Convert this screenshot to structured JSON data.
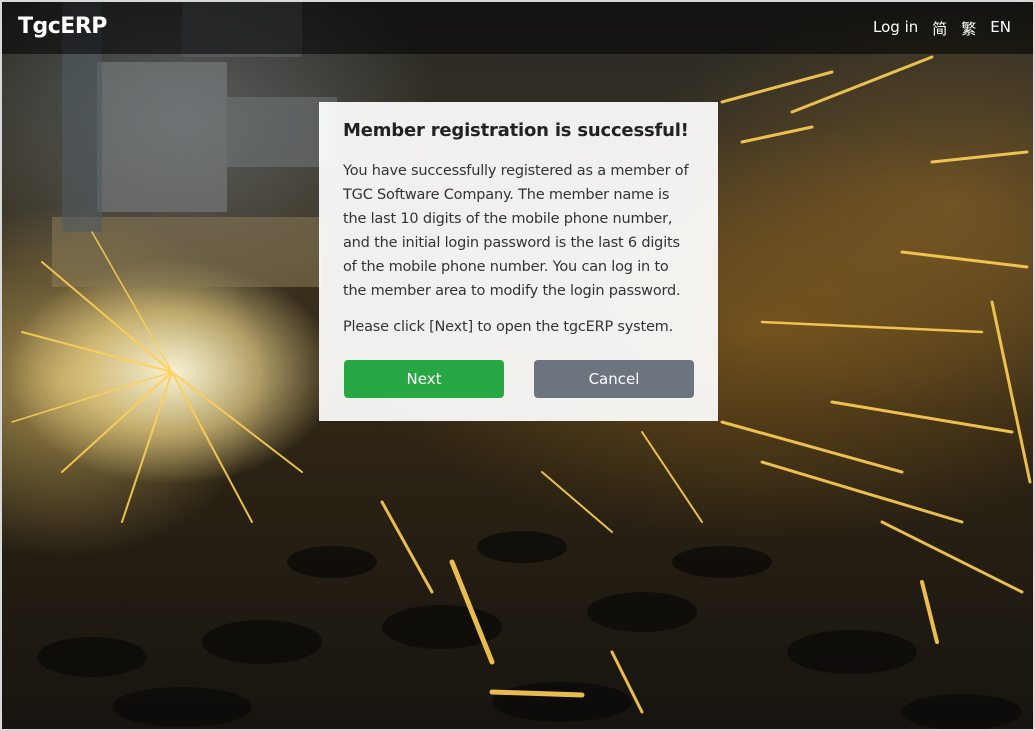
{
  "header": {
    "brand": "TgcERP",
    "nav": {
      "login": "Log in",
      "simplified": "简",
      "traditional": "繁",
      "english": "EN"
    }
  },
  "dialog": {
    "title": "Member registration is successful!",
    "message": "You have successfully registered as a member of TGC Software Company. The member name is the last 10 digits of the mobile phone number, and the initial login password is the last 6 digits of the mobile phone number. You can log in to the member area to modify the login password.",
    "note": "Please click [Next] to open the tgcERP system.",
    "next_label": "Next",
    "cancel_label": "Cancel"
  },
  "colors": {
    "next_button": "#28a745",
    "cancel_button": "#6c757d",
    "header_bar": "#000000"
  }
}
